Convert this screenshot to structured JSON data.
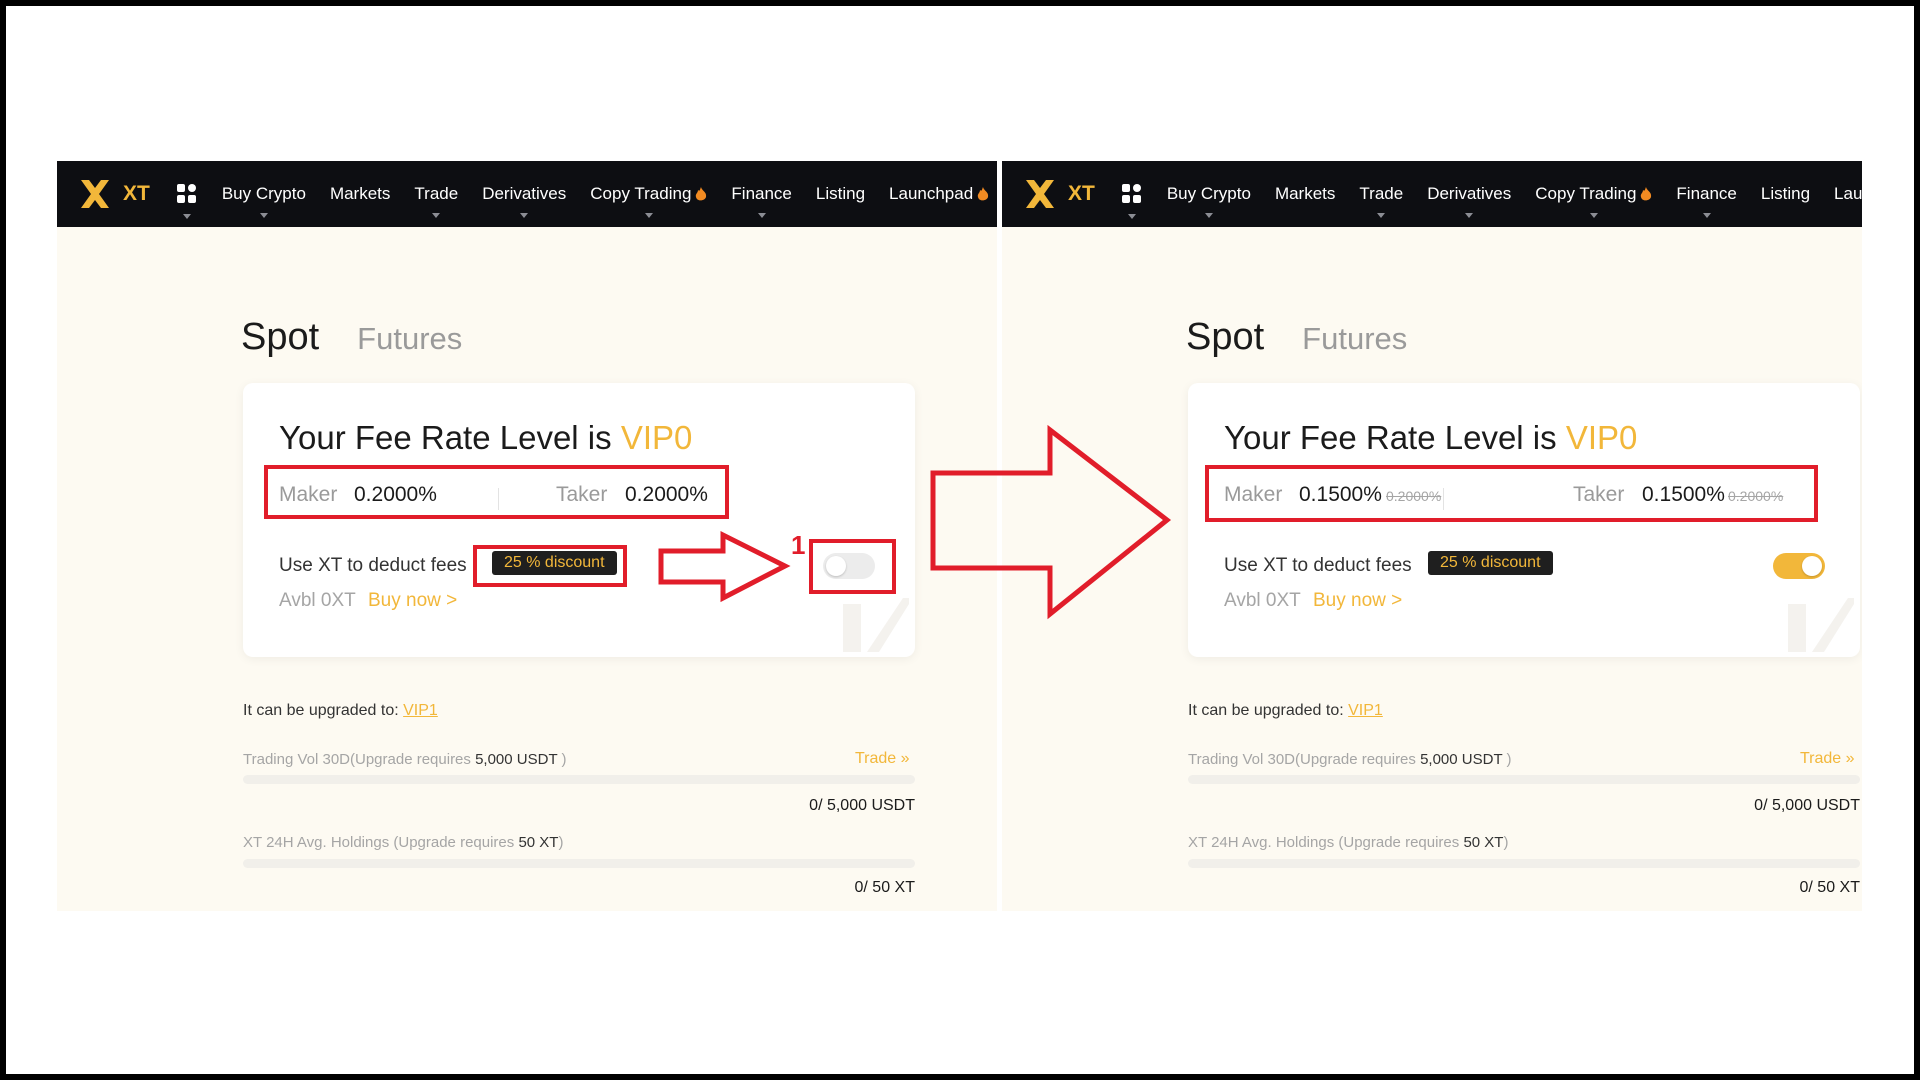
{
  "left": {
    "nav": {
      "logo_text": "XT",
      "items": [
        {
          "label": "Buy Crypto",
          "caret": true
        },
        {
          "label": "Markets",
          "caret": false
        },
        {
          "label": "Trade",
          "caret": true
        },
        {
          "label": "Derivatives",
          "caret": true
        },
        {
          "label": "Copy Trading",
          "caret": true,
          "hot": true
        },
        {
          "label": "Finance",
          "caret": true
        },
        {
          "label": "Listing",
          "caret": false
        },
        {
          "label": "Launchpad",
          "caret": false,
          "hot": true
        }
      ]
    },
    "tabs": {
      "spot": "Spot",
      "futures": "Futures"
    },
    "fee": {
      "title_prefix": "Your Fee Rate Level is",
      "level": "VIP0",
      "maker_label": "Maker",
      "maker_value": "0.2000%",
      "maker_old": "",
      "taker_label": "Taker",
      "taker_value": "0.2000%",
      "taker_old": "",
      "deduct_label": "Use XT to deduct fees",
      "discount": "25 % discount",
      "toggle_on": false,
      "avbl": "Avbl 0XT",
      "buy_now": "Buy now >"
    },
    "upgrade": {
      "label": "It can be upgraded to:",
      "level": "VIP1",
      "trading_req_prefix": "Trading Vol 30D(Upgrade requires",
      "trading_req_amount": "5,000 USDT",
      "trading_req_suffix": ")",
      "trade_link": "Trade",
      "trading_progress": 0,
      "trading_value": "0/ 5,000 USDT",
      "holding_req_prefix": "XT 24H Avg. Holdings (Upgrade requires",
      "holding_req_amount": "50 XT",
      "holding_req_suffix": ")",
      "holding_progress": 0,
      "holding_value": "0/ 50 XT"
    },
    "step_label": "1"
  },
  "right": {
    "nav": {
      "logo_text": "XT",
      "items": [
        {
          "label": "Buy Crypto",
          "caret": true
        },
        {
          "label": "Markets",
          "caret": false
        },
        {
          "label": "Trade",
          "caret": true
        },
        {
          "label": "Derivatives",
          "caret": true
        },
        {
          "label": "Copy Trading",
          "caret": true,
          "hot": true
        },
        {
          "label": "Finance",
          "caret": true
        },
        {
          "label": "Listing",
          "caret": false
        },
        {
          "label": "Launchpad",
          "caret": false,
          "hot": true
        }
      ]
    },
    "tabs": {
      "spot": "Spot",
      "futures": "Futures"
    },
    "fee": {
      "title_prefix": "Your Fee Rate Level is",
      "level": "VIP0",
      "maker_label": "Maker",
      "maker_value": "0.1500%",
      "maker_old": "0.2000%",
      "taker_label": "Taker",
      "taker_value": "0.1500%",
      "taker_old": "0.2000%",
      "deduct_label": "Use XT to deduct fees",
      "discount": "25 % discount",
      "toggle_on": true,
      "avbl": "Avbl 0XT",
      "buy_now": "Buy now >"
    },
    "upgrade": {
      "label": "It can be upgraded to:",
      "level": "VIP1",
      "trading_req_prefix": "Trading Vol 30D(Upgrade requires",
      "trading_req_amount": "5,000 USDT",
      "trading_req_suffix": ")",
      "trade_link": "Trade",
      "trading_progress": 0,
      "trading_value": "0/ 5,000 USDT",
      "holding_req_prefix": "XT 24H Avg. Holdings (Upgrade requires",
      "holding_req_amount": "50 XT",
      "holding_req_suffix": ")",
      "holding_progress": 0,
      "holding_value": "0/ 50 XT"
    }
  },
  "colors": {
    "accent": "#f2b73a",
    "annotation": "#e11d2a",
    "navbar": "#0d0e12",
    "panel_bg": "#fdfaf2"
  },
  "icons": {
    "logo": "xt-logo-icon",
    "apps": "apps-grid-icon",
    "hot": "fire-icon",
    "trade": "double-chevron-right-icon",
    "annotation_arrow": "arrow-right-icon"
  }
}
